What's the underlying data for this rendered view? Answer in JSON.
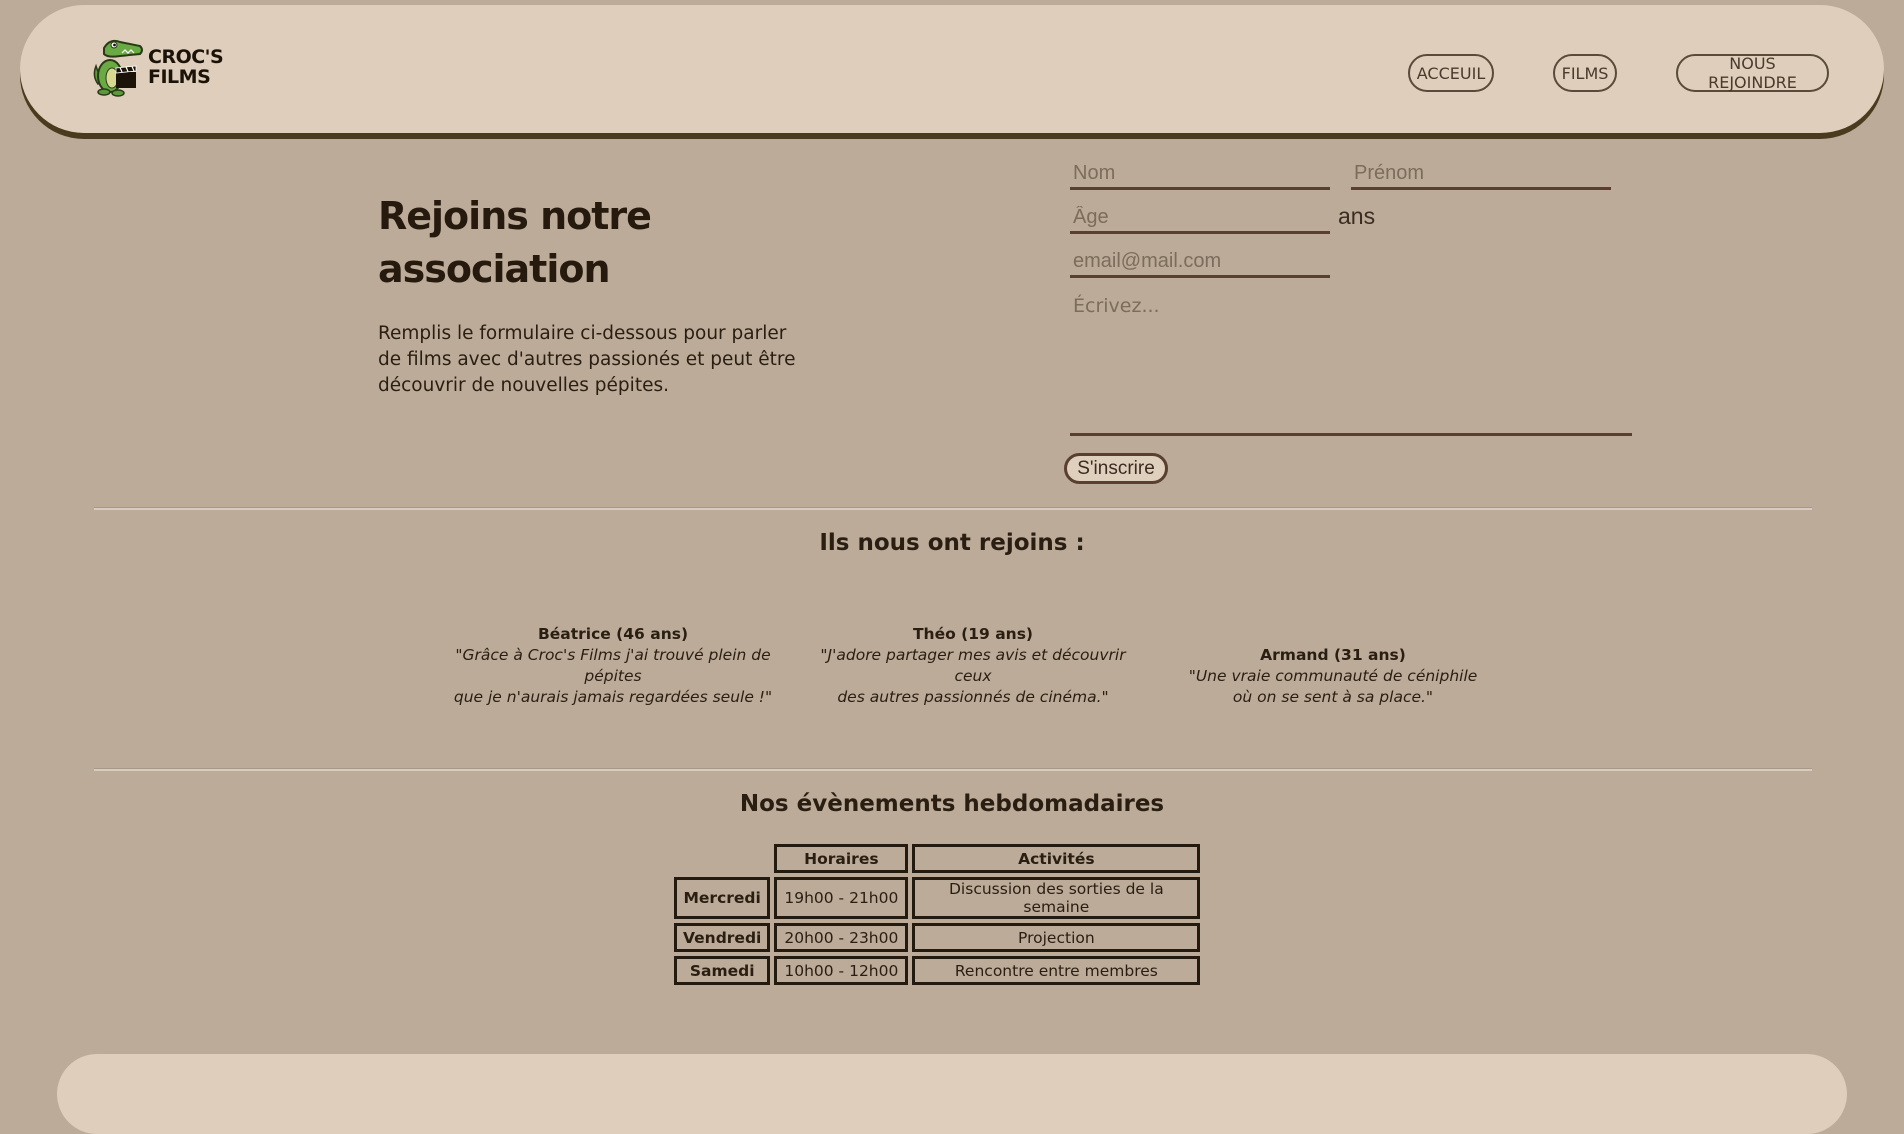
{
  "header": {
    "logo": {
      "line1": "CROC'S",
      "line2": "FILMS",
      "icon": "crocodile-clapperboard-logo"
    },
    "nav": [
      {
        "label": "ACCEUIL"
      },
      {
        "label": "FILMS"
      },
      {
        "label": "NOUS REJOINDRE"
      }
    ]
  },
  "hero": {
    "title": "Rejoins notre association",
    "description": "Remplis le formulaire ci-dessous pour parler de films avec d'autres passionés et peut être découvrir de nouvelles pépites."
  },
  "form": {
    "nom_placeholder": "Nom",
    "prenom_placeholder": "Prénom",
    "age_placeholder": "Âge",
    "age_unit": "ans",
    "email_placeholder": "email@mail.com",
    "message_placeholder": "Écrivez...",
    "submit_label": "S'inscrire"
  },
  "testimonials": {
    "title": "Ils nous ont rejoins :",
    "items": [
      {
        "name": "Béatrice (46 ans)",
        "quote": "\"Grâce à Croc's Films j'ai trouvé plein de pépites\nque je n'aurais jamais regardées seule !\""
      },
      {
        "name": "Théo (19 ans)",
        "quote": "\"J'adore partager mes avis et découvrir ceux\ndes autres passionnés de cinéma.\""
      },
      {
        "name": "Armand (31 ans)",
        "quote": "\"Une vraie communauté de céniphile\noù on se sent à sa place.\""
      }
    ]
  },
  "events": {
    "title": "Nos évènements hebdomadaires",
    "headers": [
      "Horaires",
      "Activités"
    ],
    "rows": [
      {
        "day": "Mercredi",
        "hours": "19h00 - 21h00",
        "activity": "Discussion des sorties de la semaine"
      },
      {
        "day": "Vendredi",
        "hours": "20h00 - 23h00",
        "activity": "Projection"
      },
      {
        "day": "Samedi",
        "hours": "10h00 - 12h00",
        "activity": "Rencontre entre membres"
      }
    ]
  },
  "colors": {
    "background": "#bbab98",
    "header_bg": "#decebb",
    "header_shadow": "#4a3a1e",
    "text_dark": "#2a1e12",
    "field_underline": "#5a3e30",
    "logo_green": "#5a9a3a"
  }
}
